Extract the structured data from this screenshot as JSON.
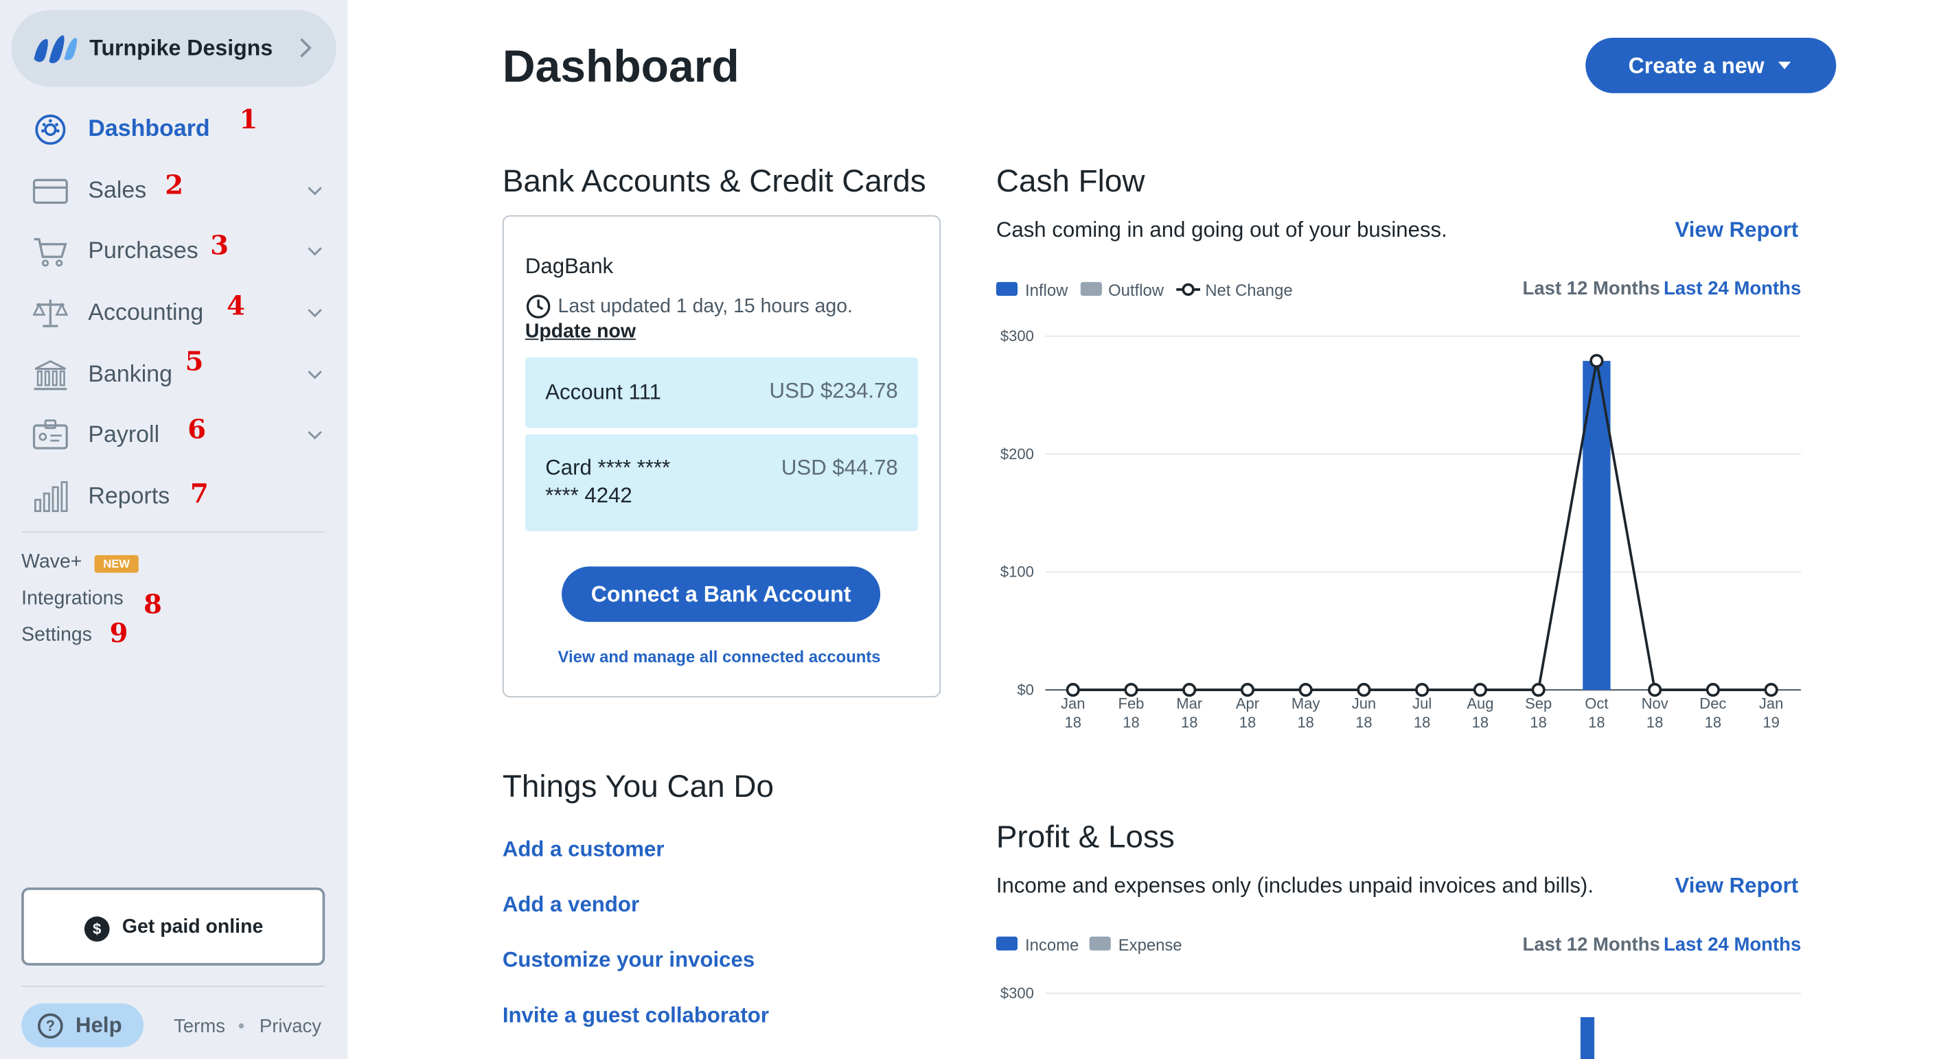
{
  "sidebar": {
    "business_name": "Turnpike Designs",
    "nav": [
      {
        "label": "Dashboard",
        "marker": "1"
      },
      {
        "label": "Sales",
        "marker": "2"
      },
      {
        "label": "Purchases",
        "marker": "3"
      },
      {
        "label": "Accounting",
        "marker": "4"
      },
      {
        "label": "Banking",
        "marker": "5"
      },
      {
        "label": "Payroll",
        "marker": "6"
      },
      {
        "label": "Reports",
        "marker": "7"
      }
    ],
    "wave_plus": "Wave+",
    "new_badge": "NEW",
    "integrations": "Integrations",
    "integrations_marker": "8",
    "settings": "Settings",
    "settings_marker": "9",
    "get_paid": "Get paid online",
    "get_paid_icon": "$",
    "help": "Help",
    "help_icon": "?",
    "terms": "Terms",
    "separator": "•",
    "privacy": "Privacy",
    "accent_color": "#2463c4"
  },
  "header": {
    "title": "Dashboard",
    "create_label": "Create a new"
  },
  "bank": {
    "title": "Bank Accounts & Credit Cards",
    "bank_name": "DagBank",
    "last_updated": "Last updated 1 day, 15 hours ago.",
    "update_now": "Update now",
    "accounts": [
      {
        "name": "Account 111",
        "value": "USD $234.78"
      },
      {
        "name_line1": "Card **** ****",
        "name_line2": "**** 4242",
        "value": "USD $44.78"
      }
    ],
    "connect": "Connect a Bank Account",
    "manage": "View and manage all connected accounts"
  },
  "things": {
    "title": "Things You Can Do",
    "items": [
      "Add a customer",
      "Add a vendor",
      "Customize your invoices",
      "Invite a guest collaborator"
    ]
  },
  "cashflow": {
    "title": "Cash Flow",
    "description": "Cash coming in and going out of your business.",
    "view_report": "View Report",
    "legend": {
      "inflow": "Inflow",
      "outflow": "Outflow",
      "net": "Net Change"
    },
    "range_current": "Last 12 Months",
    "range_other": "Last 24 Months"
  },
  "pnl": {
    "title": "Profit & Loss",
    "description": "Income and expenses only (includes unpaid invoices and bills).",
    "view_report": "View Report",
    "legend": {
      "income": "Income",
      "expense": "Expense"
    },
    "range_current": "Last 12 Months",
    "range_other": "Last 24 Months"
  },
  "chart_data": [
    {
      "type": "bar",
      "title": "Cash Flow",
      "categories": [
        [
          "Jan",
          "18"
        ],
        [
          "Feb",
          "18"
        ],
        [
          "Mar",
          "18"
        ],
        [
          "Apr",
          "18"
        ],
        [
          "May",
          "18"
        ],
        [
          "Jun",
          "18"
        ],
        [
          "Jul",
          "18"
        ],
        [
          "Aug",
          "18"
        ],
        [
          "Sep",
          "18"
        ],
        [
          "Oct",
          "18"
        ],
        [
          "Nov",
          "18"
        ],
        [
          "Dec",
          "18"
        ],
        [
          "Jan",
          "19"
        ]
      ],
      "series": [
        {
          "name": "Inflow",
          "type": "bar",
          "color": "#2463c4",
          "values": [
            0,
            0,
            0,
            0,
            0,
            0,
            0,
            0,
            0,
            279,
            0,
            0,
            0
          ]
        },
        {
          "name": "Outflow",
          "type": "bar",
          "color": "#97a5b3",
          "values": [
            0,
            0,
            0,
            0,
            0,
            0,
            0,
            0,
            0,
            0,
            0,
            0,
            0
          ]
        },
        {
          "name": "Net Change",
          "type": "line",
          "color": "#1c252c",
          "values": [
            0,
            0,
            0,
            0,
            0,
            0,
            0,
            0,
            0,
            279,
            0,
            0,
            0
          ]
        }
      ],
      "yticks": [
        0,
        100,
        200,
        300
      ],
      "ytick_labels": [
        "$0",
        "$100",
        "$200",
        "$300"
      ],
      "ylim": [
        0,
        300
      ],
      "grid": true,
      "legend": "top-left"
    },
    {
      "type": "bar",
      "title": "Profit & Loss",
      "series": [
        {
          "name": "Income",
          "color": "#2463c4"
        },
        {
          "name": "Expense",
          "color": "#97a5b3"
        }
      ],
      "ytick_labels": [
        "$300"
      ],
      "ylim": [
        0,
        300
      ],
      "grid": true,
      "legend": "top-left"
    }
  ]
}
